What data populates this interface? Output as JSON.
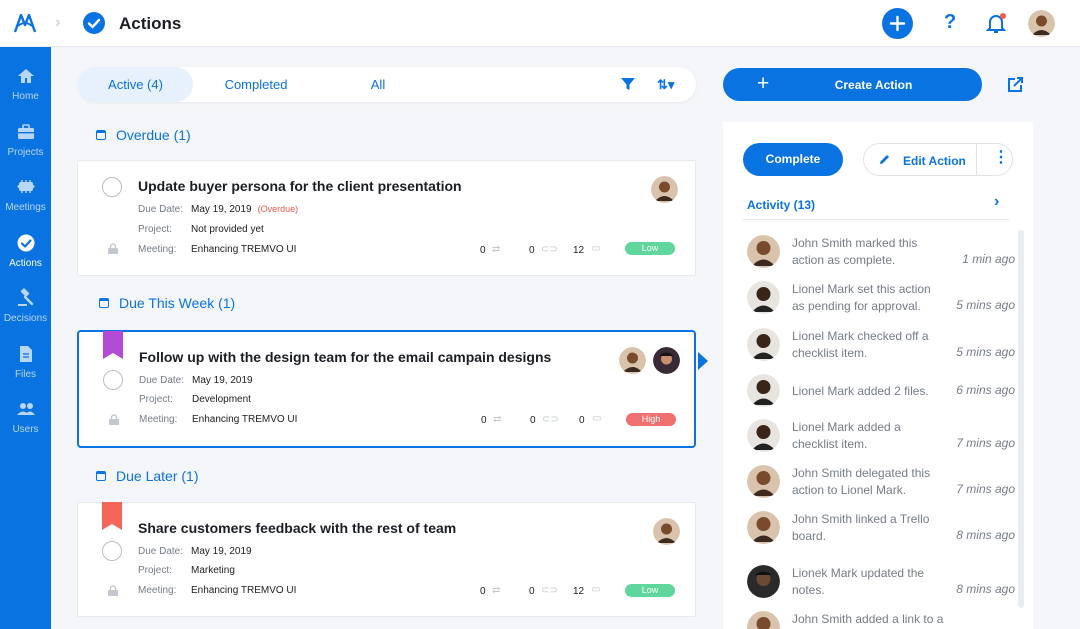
{
  "header": {
    "title": "Actions",
    "help_glyph": "?",
    "icons": [
      "app-logo",
      "chevron-right-icon",
      "check-circle-icon",
      "plus-icon",
      "help-icon",
      "bell-icon",
      "avatar"
    ]
  },
  "sidebar": {
    "items": [
      {
        "label": "Home",
        "icon": "home-icon"
      },
      {
        "label": "Projects",
        "icon": "briefcase-icon"
      },
      {
        "label": "Meetings",
        "icon": "meeting-icon"
      },
      {
        "label": "Actions",
        "icon": "check-circle-icon",
        "active": true
      },
      {
        "label": "Decisions",
        "icon": "gavel-icon"
      },
      {
        "label": "Files",
        "icon": "file-icon"
      },
      {
        "label": "Users",
        "icon": "users-icon"
      }
    ]
  },
  "tabs": [
    {
      "label": "Active (4)",
      "active": true
    },
    {
      "label": "Completed"
    },
    {
      "label": "All"
    }
  ],
  "sort_glyph": "⇅▾",
  "groups": [
    {
      "heading": "Overdue (1)",
      "cards": [
        {
          "title": "Update buyer persona for the client presentation",
          "due_label": "Due Date:",
          "due": "May 19, 2019",
          "overdue_note": "(Overdue)",
          "project_label": "Project:",
          "project": "Not provided yet",
          "meeting_label": "Meeting:",
          "meeting": "Enhancing TREMVO UI",
          "counts": [
            "0",
            "0",
            "12"
          ],
          "priority": "Low"
        }
      ]
    },
    {
      "heading": "Due This Week (1)",
      "cards": [
        {
          "title": "Follow up with the design team for the email campain designs",
          "due_label": "Due Date:",
          "due": "May 19, 2019",
          "project_label": "Project:",
          "project": "Development",
          "meeting_label": "Meeting:",
          "meeting": "Enhancing TREMVO UI",
          "counts": [
            "0",
            "0",
            "0"
          ],
          "priority": "High",
          "flag_color": "#b44bd6"
        }
      ]
    },
    {
      "heading": "Due Later (1)",
      "cards": [
        {
          "title": "Share customers feedback with the rest of team",
          "due_label": "Due Date:",
          "due": "May 19, 2019",
          "project_label": "Project:",
          "project": "Marketing",
          "meeting_label": "Meeting:",
          "meeting": "Enhancing TREMVO UI",
          "counts": [
            "0",
            "0",
            "12"
          ],
          "priority": "Low",
          "flag_color": "#f4655a"
        }
      ]
    }
  ],
  "panel": {
    "create_label": "Create Action",
    "create_glyph": "+",
    "complete_label": "Complete",
    "edit_label": "Edit Action",
    "more_glyph": "⋮",
    "activity_heading": "Activity (13)",
    "activity_chevron": "›",
    "activity": [
      {
        "text": "John Smith marked this action as complete.",
        "time": "1 min ago"
      },
      {
        "text": "Lionel Mark set this action as pending for approval.",
        "time": "5 mins ago"
      },
      {
        "text": "Lionel Mark checked off a checklist item.",
        "time": "5 mins ago"
      },
      {
        "text": "Lionel Mark added 2 files.",
        "time": "6 mins ago"
      },
      {
        "text": "Lionel Mark added a checklist item.",
        "time": "7 mins ago"
      },
      {
        "text": "John Smith delegated this action to Lionel Mark.",
        "time": "7 mins ago"
      },
      {
        "text": "John Smith linked a Trello board.",
        "time": "8 mins ago"
      },
      {
        "text": "Lionek Mark updated the notes.",
        "time": "8 mins ago"
      },
      {
        "text": "John Smith added a link to a",
        "time": ""
      }
    ]
  },
  "colors": {
    "accent": "#0a73e2",
    "low": "#5fd69b",
    "high": "#f07070",
    "overdue": "#f05a4b"
  }
}
